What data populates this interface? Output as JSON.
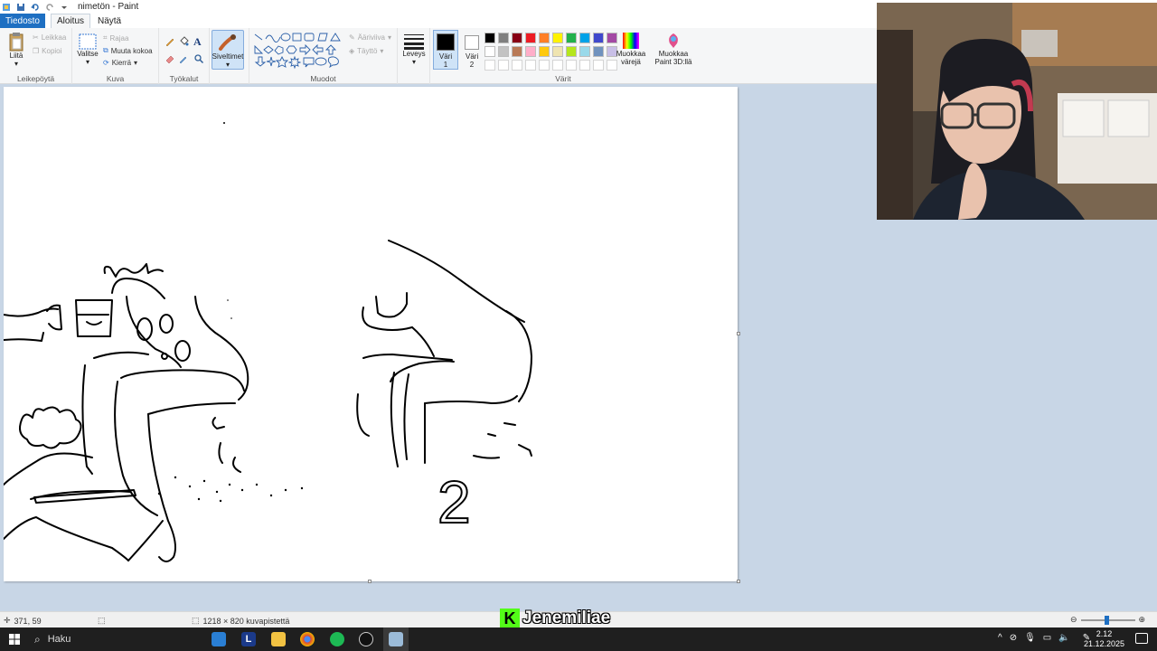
{
  "window": {
    "title": "nimetön - Paint"
  },
  "tabs": {
    "file": "Tiedosto",
    "home": "Aloitus",
    "view": "Näytä"
  },
  "ribbon": {
    "clipboard": {
      "label": "Leikepöytä",
      "paste": "Liitä",
      "cut": "Leikkaa",
      "copy": "Kopioi"
    },
    "image": {
      "label": "Kuva",
      "select": "Valitse",
      "crop": "Rajaa",
      "resize": "Muuta kokoa",
      "rotate": "Kierrä"
    },
    "tools": {
      "label": "Työkalut"
    },
    "brushes": {
      "label": "Siveltimet"
    },
    "shapes": {
      "label": "Muodot",
      "outline": "Ääriviiva",
      "fill": "Täyttö"
    },
    "size": {
      "label": "Leveys"
    },
    "colors": {
      "label": "Värit",
      "color1": "Väri 1",
      "color2": "Väri 2",
      "edit": "Muokkaa värejä",
      "paint3d": "Muokkaa Paint 3D:llä",
      "palette_row1": [
        "#000000",
        "#7f7f7f",
        "#880015",
        "#ed1c24",
        "#ff7f27",
        "#fff200",
        "#22b14c",
        "#00a2e8",
        "#3f48cc",
        "#a349a4"
      ],
      "palette_row2": [
        "#ffffff",
        "#c3c3c3",
        "#b97a57",
        "#ffaec9",
        "#ffc90e",
        "#efe4b0",
        "#b5e61d",
        "#99d9ea",
        "#7092be",
        "#c8bfe7"
      ]
    }
  },
  "canvas": {
    "drawn_digit": "2"
  },
  "status": {
    "cursor": "371, 59",
    "size": "1218 × 820 kuvapistettä"
  },
  "stream": {
    "letter": "K",
    "name": "Jenemiliae"
  },
  "taskbar": {
    "search": "Haku",
    "time": "2.12",
    "date": "21.12.2025"
  }
}
